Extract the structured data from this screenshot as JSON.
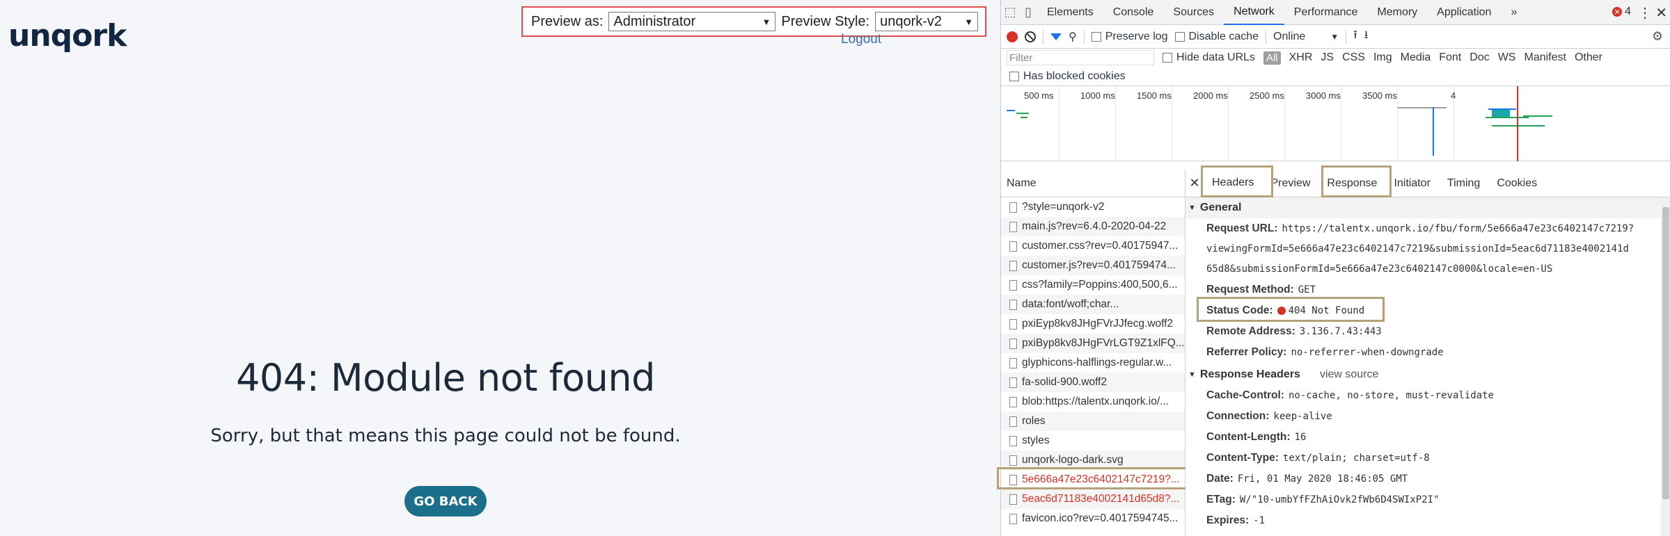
{
  "app": {
    "logo": "unqork",
    "preview_as_label": "Preview as:",
    "preview_as_value": "Administrator",
    "preview_style_label": "Preview Style:",
    "preview_style_value": "unqork-v2",
    "logout": "Logout",
    "error_title": "404: Module not found",
    "error_subtitle": "Sorry, but that means this page could not be found.",
    "go_back": "GO BACK"
  },
  "devtools": {
    "tabs": [
      "Elements",
      "Console",
      "Sources",
      "Network",
      "Performance",
      "Memory",
      "Application"
    ],
    "active_tab": "Network",
    "more_tabs": "»",
    "error_count": "4",
    "toolbar": {
      "preserve_log": "Preserve log",
      "disable_cache": "Disable cache",
      "throttle": "Online"
    },
    "filter": {
      "placeholder": "Filter",
      "hide_data_urls": "Hide data URLs",
      "all": "All",
      "types": [
        "XHR",
        "JS",
        "CSS",
        "Img",
        "Media",
        "Font",
        "Doc",
        "WS",
        "Manifest",
        "Other"
      ],
      "has_blocked_cookies": "Has blocked cookies"
    },
    "timeline_ticks": [
      "500 ms",
      "1000 ms",
      "1500 ms",
      "2000 ms",
      "2500 ms",
      "3000 ms",
      "3500 ms",
      "4"
    ],
    "requests": {
      "header": "Name",
      "rows": [
        {
          "name": "?style=unqork-v2",
          "error": false
        },
        {
          "name": "main.js?rev=6.4.0-2020-04-22",
          "error": false
        },
        {
          "name": "customer.css?rev=0.40175947...",
          "error": false
        },
        {
          "name": "customer.js?rev=0.401759474...",
          "error": false
        },
        {
          "name": "css?family=Poppins:400,500,6...",
          "error": false
        },
        {
          "name": "data:font/woff;char...",
          "error": false
        },
        {
          "name": "pxiEyp8kv8JHgFVrJJfecg.woff2",
          "error": false
        },
        {
          "name": "pxiByp8kv8JHgFVrLGT9Z1xlFQ...",
          "error": false
        },
        {
          "name": "glyphicons-halflings-regular.w...",
          "error": false
        },
        {
          "name": "fa-solid-900.woff2",
          "error": false
        },
        {
          "name": "blob:https://talentx.unqork.io/...",
          "error": false
        },
        {
          "name": "roles",
          "error": false
        },
        {
          "name": "styles",
          "error": false
        },
        {
          "name": "unqork-logo-dark.svg",
          "error": false
        },
        {
          "name": "5e666a47e23c6402147c7219?...",
          "error": true
        },
        {
          "name": "5eac6d71183e4002141d65d8?...",
          "error": true
        },
        {
          "name": "favicon.ico?rev=0.4017594745...",
          "error": false
        }
      ]
    },
    "details": {
      "tabs": [
        "Headers",
        "Preview",
        "Response",
        "Initiator",
        "Timing",
        "Cookies"
      ],
      "general_title": "General",
      "request_url_key": "Request URL:",
      "request_url_lines": [
        "https://talentx.unqork.io/fbu/form/5e666a47e23c6402147c7219?",
        "viewingFormId=5e666a47e23c6402147c7219&submissionId=5eac6d71183e4002141d",
        "65d8&submissionFormId=5e666a47e23c6402147c0000&locale=en-US"
      ],
      "request_method_key": "Request Method:",
      "request_method": "GET",
      "status_code_key": "Status Code:",
      "status_code": "404 Not Found",
      "remote_address_key": "Remote Address:",
      "remote_address": "3.136.7.43:443",
      "referrer_policy_key": "Referrer Policy:",
      "referrer_policy": "no-referrer-when-downgrade",
      "response_headers_title": "Response Headers",
      "view_source": "view source",
      "response_headers": [
        {
          "k": "Cache-Control:",
          "v": "no-cache, no-store, must-revalidate"
        },
        {
          "k": "Connection:",
          "v": "keep-alive"
        },
        {
          "k": "Content-Length:",
          "v": "16"
        },
        {
          "k": "Content-Type:",
          "v": "text/plain; charset=utf-8"
        },
        {
          "k": "Date:",
          "v": "Fri, 01 May 2020 18:46:05 GMT"
        },
        {
          "k": "ETag:",
          "v": "W/\"10-umbYfFZhAiOvk2fWb6D4SWIxP2I\""
        },
        {
          "k": "Expires:",
          "v": "-1"
        }
      ]
    }
  },
  "colors": {
    "accent_blue": "#1a73e8",
    "error_red": "#d93025",
    "highlight_box": "#b5a27a",
    "preview_border": "#e04b4b",
    "go_back_bg": "#1b6f8a"
  }
}
